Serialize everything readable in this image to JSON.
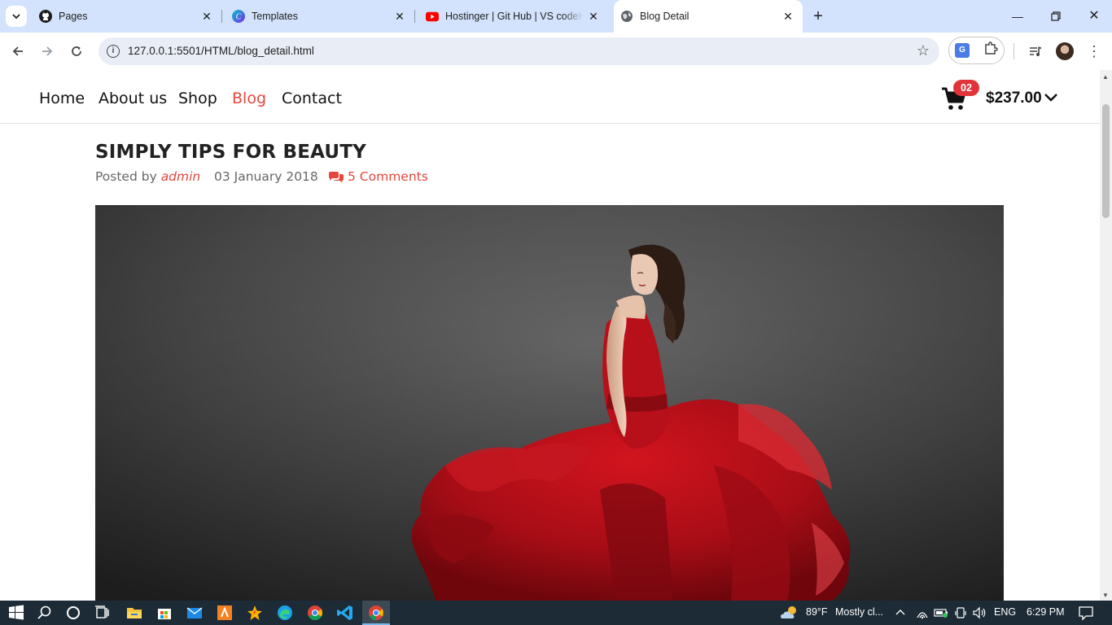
{
  "browser": {
    "tabs": [
      {
        "title": "Pages",
        "icon": "github-icon"
      },
      {
        "title": "Templates",
        "icon": "canva-icon"
      },
      {
        "title": "Hostinger | Git Hub | VS codeHo",
        "icon": "youtube-icon"
      },
      {
        "title": "Blog Detail",
        "icon": "globe-icon",
        "active": true
      }
    ],
    "url": "127.0.0.1:5501/HTML/blog_detail.html"
  },
  "nav": {
    "links": [
      "Home",
      "About us",
      "Shop",
      "Blog",
      "Contact"
    ],
    "active": "Blog",
    "cart_count": "02",
    "cart_total": "$237.00"
  },
  "post": {
    "title": "SIMPLY TIPS FOR BEAUTY",
    "posted_by_label": "Posted by",
    "author": "admin",
    "date": "03 January 2018",
    "comments": "5 Comments",
    "image": "woman-in-red-dress-photo"
  },
  "taskbar": {
    "weather": "89°F",
    "weather_desc": "Mostly cl...",
    "language": "ENG",
    "time": "6:29 PM"
  },
  "colors": {
    "accent": "#e5473d",
    "badge": "#e0333a",
    "tabbar": "#d3e3fd",
    "taskbar": "#1c2b36"
  }
}
